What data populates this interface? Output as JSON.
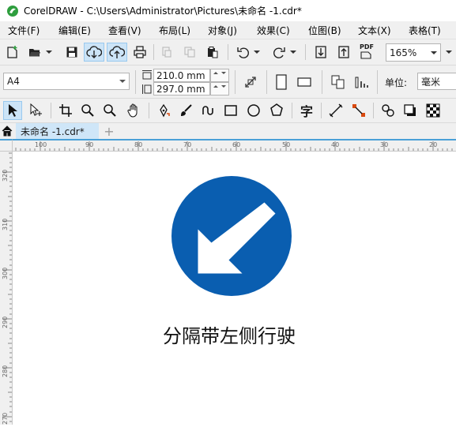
{
  "window": {
    "title": "CorelDRAW - C:\\Users\\Administrator\\Pictures\\未命名 -1.cdr*"
  },
  "menu": {
    "items": [
      {
        "label": "文件(F)",
        "name": "menu-file"
      },
      {
        "label": "编辑(E)",
        "name": "menu-edit"
      },
      {
        "label": "查看(V)",
        "name": "menu-view"
      },
      {
        "label": "布局(L)",
        "name": "menu-layout"
      },
      {
        "label": "对象(J)",
        "name": "menu-object"
      },
      {
        "label": "效果(C)",
        "name": "menu-effects"
      },
      {
        "label": "位图(B)",
        "name": "menu-bitmaps"
      },
      {
        "label": "文本(X)",
        "name": "menu-text"
      },
      {
        "label": "表格(T)",
        "name": "menu-table"
      }
    ]
  },
  "standard_toolbar": {
    "zoom_value": "165%",
    "pdf_label": "PDF"
  },
  "property_bar": {
    "page_size": "A4",
    "width": "210.0 mm",
    "height": "297.0 mm",
    "units_label": "单位:",
    "units_value": "毫米"
  },
  "toolbox": {
    "text_tool_glyph": "字"
  },
  "document_tabs": {
    "active": "未命名 -1.cdr*",
    "add_glyph": "+"
  },
  "rulers": {
    "horizontal_ticks": [
      "100",
      "90",
      "80",
      "70",
      "60",
      "50",
      "40",
      "30",
      "20"
    ],
    "vertical_ticks": [
      "320",
      "310",
      "300",
      "290",
      "280",
      "270"
    ]
  },
  "canvas": {
    "sign_caption": "分隔带左侧行驶",
    "sign_color": "#0a5eb0",
    "arrow_color": "#ffffff"
  }
}
